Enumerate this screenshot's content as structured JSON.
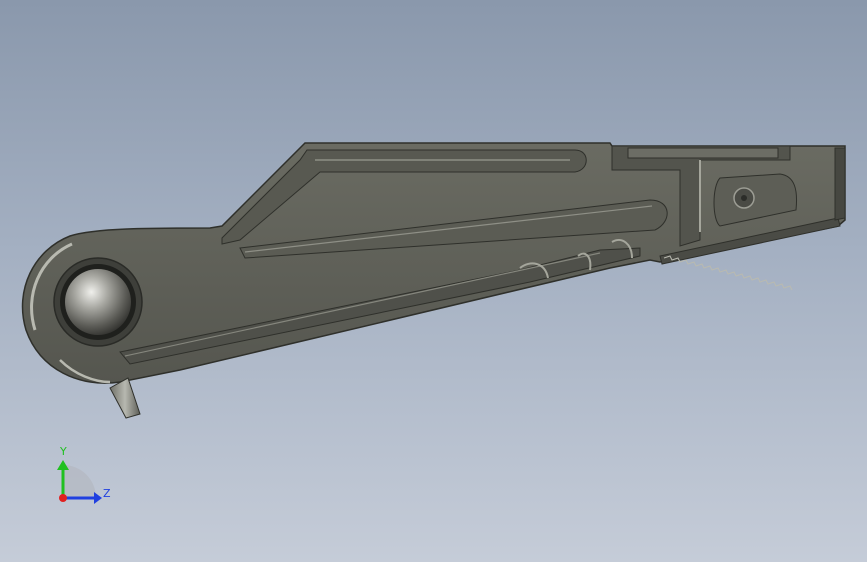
{
  "colors": {
    "background_top": "#8a98ac",
    "background_bottom": "#c5ccd8",
    "part_body": "#5f6058",
    "part_highlight": "#8a8b82",
    "part_shadow": "#3b3c36",
    "axis_x": "#e02020",
    "axis_y": "#20c020",
    "axis_z": "#2040e0"
  },
  "triad": {
    "y_label": "Y",
    "z_label": "Z"
  },
  "model": {
    "icon_names": [
      "part-body-icon",
      "ball-joint-icon",
      "lever-tab-icon",
      "gear-rack-icon"
    ]
  }
}
